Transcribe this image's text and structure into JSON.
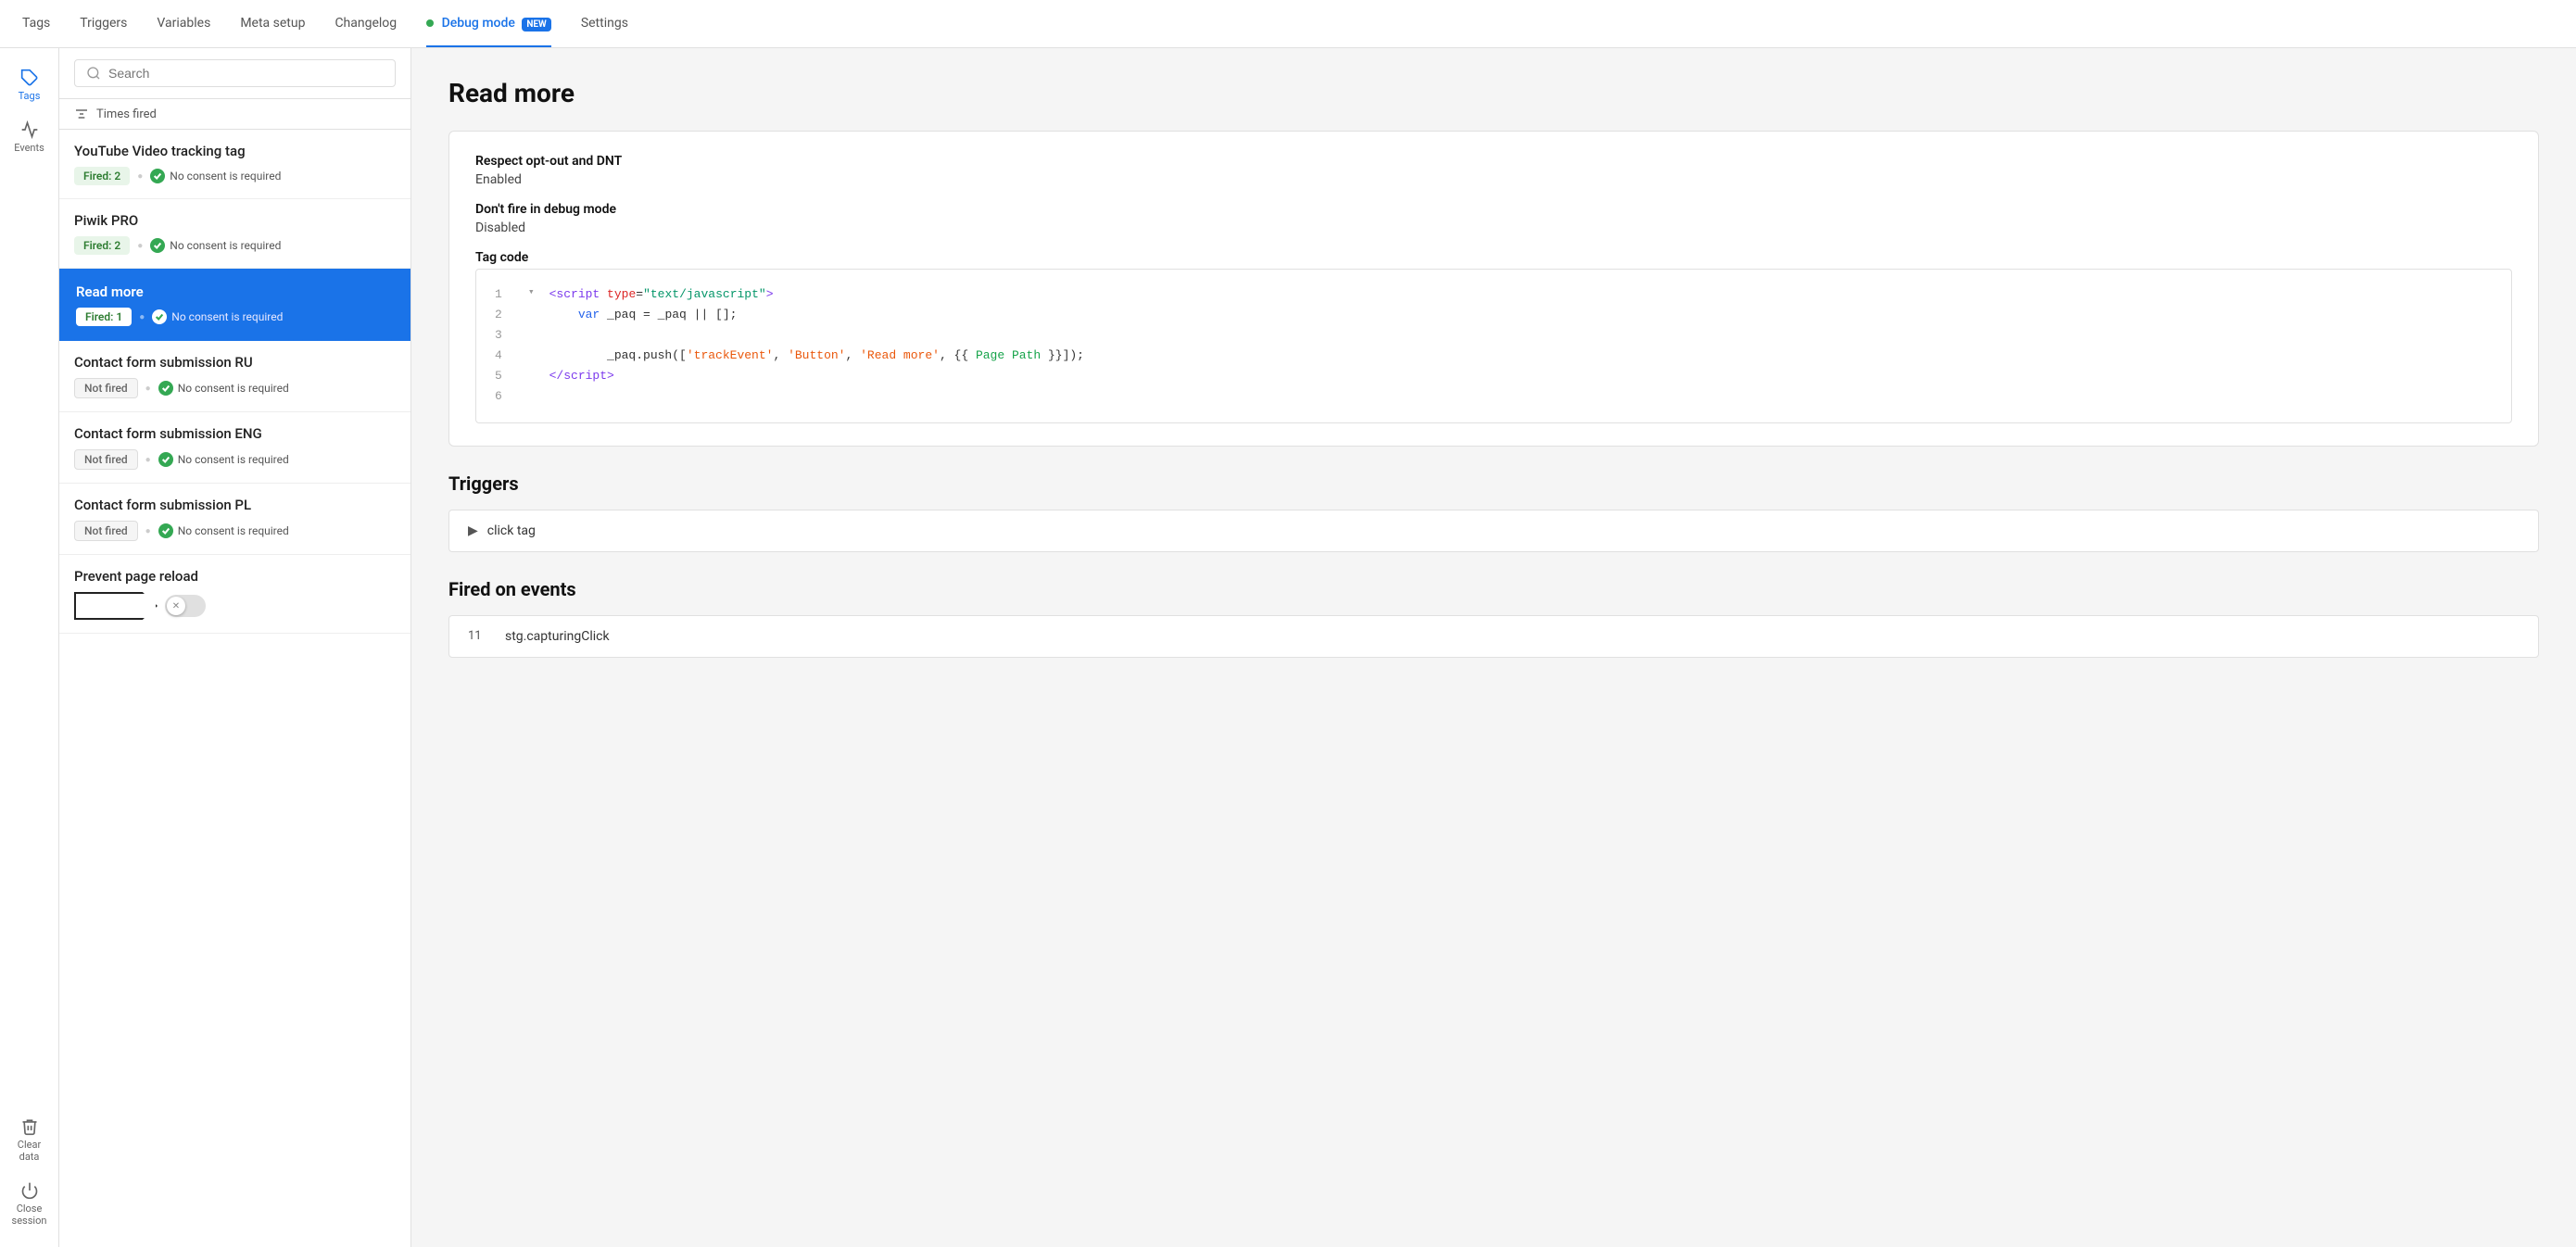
{
  "nav": {
    "items": [
      {
        "label": "Tags",
        "active": false
      },
      {
        "label": "Triggers",
        "active": false
      },
      {
        "label": "Variables",
        "active": false
      },
      {
        "label": "Meta setup",
        "active": false
      },
      {
        "label": "Changelog",
        "active": false
      },
      {
        "label": "Debug mode",
        "active": true,
        "badge": "NEW",
        "dot": true
      },
      {
        "label": "Settings",
        "active": false
      }
    ]
  },
  "sidebar": {
    "icons": [
      {
        "name": "tags",
        "label": "Tags",
        "active": true
      },
      {
        "name": "events",
        "label": "Events",
        "active": false
      }
    ]
  },
  "search": {
    "placeholder": "Search"
  },
  "times_fired_label": "Times fired",
  "tags": [
    {
      "name": "YouTube Video tracking tag",
      "status": "fired",
      "fired_count": "Fired: 2",
      "consent": "No consent is required",
      "active": false
    },
    {
      "name": "Piwik PRO",
      "status": "fired",
      "fired_count": "Fired: 2",
      "consent": "No consent is required",
      "active": false
    },
    {
      "name": "Read more",
      "status": "fired",
      "fired_count": "Fired: 1",
      "consent": "No consent is required",
      "active": true
    },
    {
      "name": "Contact form submission RU",
      "status": "not_fired",
      "fired_count": "Not fired",
      "consent": "No consent is required",
      "active": false
    },
    {
      "name": "Contact form submission ENG",
      "status": "not_fired",
      "fired_count": "Not fired",
      "consent": "No consent is required",
      "active": false
    },
    {
      "name": "Contact form submission PL",
      "status": "not_fired",
      "fired_count": "Not fired",
      "consent": "No consent is required",
      "active": false
    },
    {
      "name": "Prevent page reload",
      "status": "toggle",
      "fired_count": "",
      "consent": "",
      "active": false
    }
  ],
  "detail": {
    "title": "Read more",
    "consent_title": "No consent is required",
    "respect_opt_out_label": "Respect opt-out and DNT",
    "respect_opt_out_value": "Enabled",
    "dont_fire_label": "Don't fire in debug mode",
    "dont_fire_value": "Disabled",
    "tag_code_label": "Tag code",
    "code_lines": [
      {
        "num": "1",
        "content_html": "<span class='kw-script'>&lt;script</span> <span class='kw-attr'>type</span>=<span class='kw-val'>\"text/javascript\"</span><span class='kw-script'>&gt;</span>"
      },
      {
        "num": "2",
        "content_html": "&nbsp;&nbsp;&nbsp;&nbsp;<span class='kw-var'>var</span> _paq = _paq || [];"
      },
      {
        "num": "3",
        "content_html": ""
      },
      {
        "num": "4",
        "content_html": "&nbsp;&nbsp;&nbsp;&nbsp;&nbsp;&nbsp;&nbsp;&nbsp;_paq.push([<span class='kw-str'>'trackEvent'</span>, <span class='kw-str'>'Button'</span>, <span class='kw-str'>'Read more'</span>, {{ <span class='kw-tpl'>Page Path</span> }}]);"
      },
      {
        "num": "5",
        "content_html": "<span class='kw-script'>&lt;/script&gt;</span>"
      },
      {
        "num": "6",
        "content_html": ""
      }
    ],
    "triggers_label": "Triggers",
    "trigger_name": "click tag",
    "fired_on_label": "Fired on events",
    "event_num": "11",
    "event_name": "stg.capturingClick"
  },
  "clear_data_label": "Clear data",
  "close_session_label": "Close session"
}
